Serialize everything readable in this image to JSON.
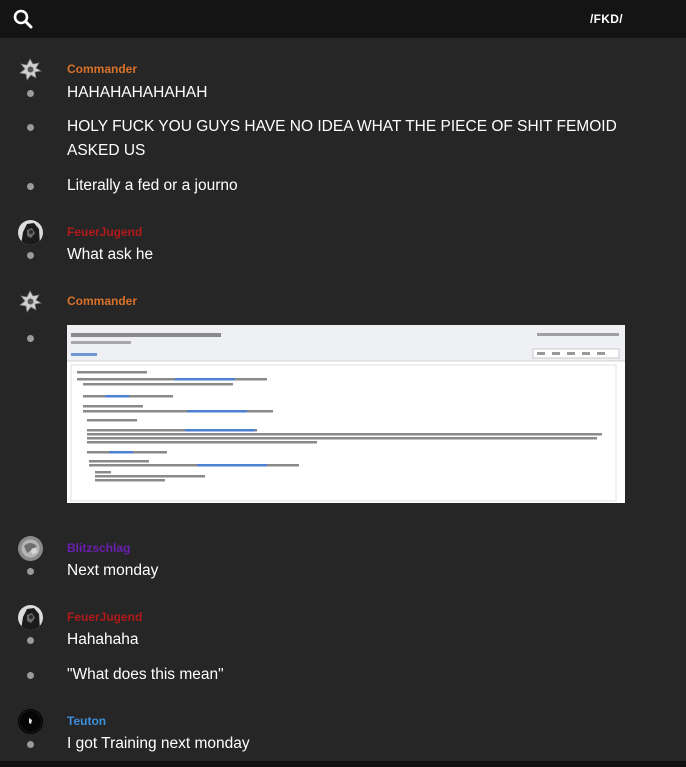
{
  "header": {
    "channel": "/FKD/",
    "search_icon": "search-icon"
  },
  "colors": {
    "background": "#262626",
    "topbar": "#141414",
    "commander": "#d9712a",
    "feuerjugend": "#b11a1a",
    "blitzschlag": "#6a1fb0",
    "teuton": "#3d8fd9"
  },
  "messages": [
    {
      "author": "Commander",
      "texts": [
        "HAHAHAHAHAHAH",
        "HOLY FUCK YOU GUYS HAVE NO IDEA WHAT THE PIECE OF SHIT FEMOID ASKED US",
        "Literally a fed or a journo"
      ]
    },
    {
      "author": "FeuerJugend",
      "texts": [
        "What ask he"
      ]
    },
    {
      "author": "Commander",
      "texts": [],
      "attachment": "email-screenshot"
    },
    {
      "author": "Blitzschlag",
      "texts": [
        "Next monday"
      ]
    },
    {
      "author": "FeuerJugend",
      "texts": [
        "Hahahaha",
        "\"What does this mean\""
      ]
    },
    {
      "author": "Teuton",
      "texts": [
        "I got Training next monday"
      ]
    }
  ]
}
